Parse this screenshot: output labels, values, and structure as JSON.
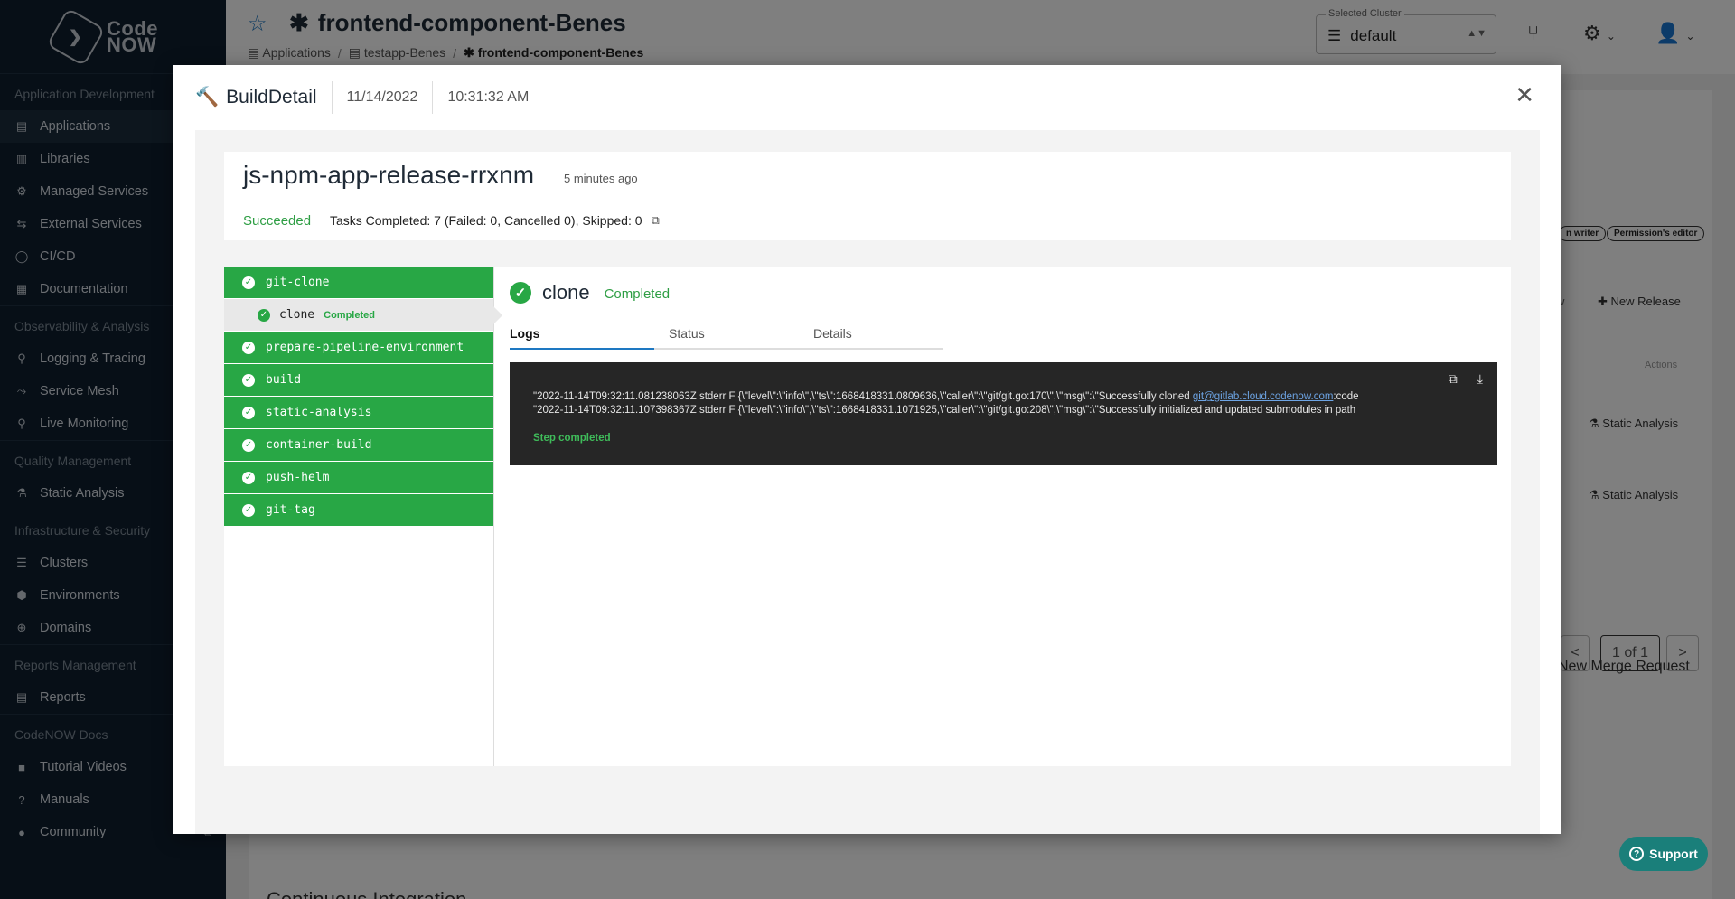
{
  "brand": {
    "logo_line1": "Code",
    "logo_line2": "NOW"
  },
  "sidebar": {
    "sections": [
      {
        "title": "Application Development",
        "items": [
          {
            "label": "Applications",
            "icon": "▤",
            "icon_name": "applications-icon",
            "active": true
          },
          {
            "label": "Libraries",
            "icon": "▥",
            "icon_name": "libraries-icon"
          },
          {
            "label": "Managed Services",
            "icon": "⚙",
            "icon_name": "managed-services-icon"
          },
          {
            "label": "External Services",
            "icon": "⇆",
            "icon_name": "external-services-icon"
          },
          {
            "label": "CI/CD",
            "icon": "◯",
            "icon_name": "cicd-icon"
          },
          {
            "label": "Documentation",
            "icon": "▦",
            "icon_name": "documentation-icon"
          }
        ]
      },
      {
        "title": "Observability & Analysis",
        "items": [
          {
            "label": "Logging & Tracing",
            "icon": "⚲",
            "icon_name": "logging-icon"
          },
          {
            "label": "Service Mesh",
            "icon": "⤳",
            "icon_name": "service-mesh-icon"
          },
          {
            "label": "Live Monitoring",
            "icon": "⚲",
            "icon_name": "live-monitoring-icon"
          }
        ]
      },
      {
        "title": "Quality Management",
        "items": [
          {
            "label": "Static Analysis",
            "icon": "⚗",
            "icon_name": "static-analysis-icon"
          }
        ]
      },
      {
        "title": "Infrastructure & Security",
        "items": [
          {
            "label": "Clusters",
            "icon": "☰",
            "icon_name": "clusters-icon"
          },
          {
            "label": "Environments",
            "icon": "⬢",
            "icon_name": "environments-icon"
          },
          {
            "label": "Domains",
            "icon": "⊕",
            "icon_name": "domains-icon"
          }
        ]
      },
      {
        "title": "Reports Management",
        "items": [
          {
            "label": "Reports",
            "icon": "▤",
            "icon_name": "reports-icon"
          }
        ]
      },
      {
        "title": "CodeNOW Docs",
        "items": [
          {
            "label": "Tutorial Videos",
            "icon": "■",
            "icon_name": "video-icon"
          },
          {
            "label": "Manuals",
            "icon": "?",
            "icon_name": "manuals-icon",
            "external": true
          },
          {
            "label": "Community",
            "icon": "●",
            "icon_name": "community-icon",
            "external": true
          }
        ]
      }
    ]
  },
  "header": {
    "title": "frontend-component-Benes",
    "breadcrumb": [
      "Applications",
      "testapp-Benes",
      "frontend-component-Benes"
    ],
    "cluster_label": "Selected Cluster",
    "cluster_value": "default"
  },
  "background": {
    "chip1": "n writer",
    "chip2": "Permission's editor",
    "new_release": "New Release",
    "view_partial": "w",
    "actions": "Actions",
    "static_analysis": "Static Analysis",
    "pager_prev": "<",
    "pager_info": "1 of 1",
    "pager_next": ">",
    "new_merge_request": "New Merge Request",
    "ci_heading": "Continuous Integration"
  },
  "modal": {
    "title": "BuildDetail",
    "date": "11/14/2022",
    "time": "10:31:32 AM",
    "run_name": "js-npm-app-release-rrxnm",
    "run_ago": "5 minutes ago",
    "run_status": "Succeeded",
    "tasks_summary": "Tasks Completed: 7 (Failed: 0, Cancelled 0), Skipped: 0",
    "steps": [
      {
        "name": "git-clone"
      },
      {
        "name": "clone",
        "sub": true,
        "status": "Completed"
      },
      {
        "name": "prepare-pipeline-environment"
      },
      {
        "name": "build"
      },
      {
        "name": "static-analysis"
      },
      {
        "name": "container-build"
      },
      {
        "name": "push-helm"
      },
      {
        "name": "git-tag"
      }
    ],
    "pane_title": "clone",
    "pane_status": "Completed",
    "tabs": [
      "Logs",
      "Status",
      "Details"
    ],
    "active_tab": 0,
    "log_line1_pre": "\"2022-11-14T09:32:11.081238063Z stderr F {\\\"level\\\":\\\"info\\\",\\\"ts\\\":1668418331.0809636,\\\"caller\\\":\\\"git/git.go:170\\\",\\\"msg\\\":\\\"Successfully cloned ",
    "log_line1_link": "git@gitlab.cloud.codenow.com",
    "log_line1_post": ":code",
    "log_line2": "\"2022-11-14T09:32:11.107398367Z stderr F {\\\"level\\\":\\\"info\\\",\\\"ts\\\":1668418331.1071925,\\\"caller\\\":\\\"git/git.go:208\\\",\\\"msg\\\":\\\"Successfully initialized and updated submodules in path",
    "log_done": "Step completed"
  },
  "support": {
    "label": "Support"
  },
  "colors": {
    "success": "#28a745",
    "sidebar_bg": "#0f1e2e",
    "accent": "#1e78c2",
    "log_bg": "#262626"
  }
}
